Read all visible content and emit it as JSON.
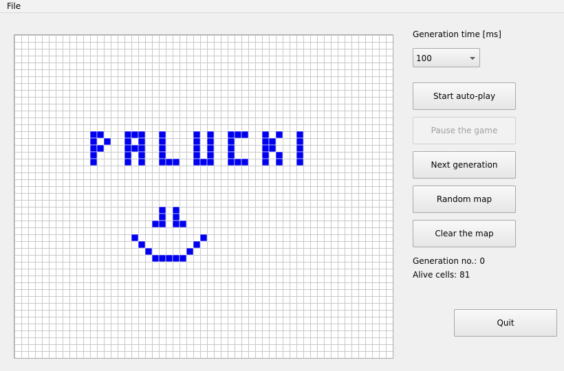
{
  "menu": {
    "file_label": "File"
  },
  "controls": {
    "generation_time_label": "Generation time [ms]",
    "generation_time_value": "100",
    "buttons": {
      "start": "Start auto-play",
      "pause": "Pause the game",
      "next": "Next generation",
      "random": "Random map",
      "clear": "Clear the map",
      "quit": "Quit"
    },
    "generation_no_label": "Generation no.:",
    "generation_no_value": "0",
    "alive_cells_label": "Alive cells:",
    "alive_cells_value": "81"
  },
  "colors": {
    "cell_alive": "#0000ee",
    "grid_line": "#c8c8c8",
    "grid_background": "#ffffff"
  },
  "board": {
    "columns": 55,
    "rows": 47,
    "alive_cells": [
      [
        11,
        14
      ],
      [
        11,
        15
      ],
      [
        11,
        16
      ],
      [
        11,
        17
      ],
      [
        11,
        18
      ],
      [
        12,
        14
      ],
      [
        12,
        16
      ],
      [
        13,
        15
      ],
      [
        16,
        14
      ],
      [
        16,
        15
      ],
      [
        16,
        16
      ],
      [
        16,
        17
      ],
      [
        16,
        18
      ],
      [
        17,
        14
      ],
      [
        17,
        16
      ],
      [
        18,
        14
      ],
      [
        18,
        15
      ],
      [
        18,
        16
      ],
      [
        18,
        17
      ],
      [
        18,
        18
      ],
      [
        21,
        14
      ],
      [
        21,
        15
      ],
      [
        21,
        16
      ],
      [
        21,
        17
      ],
      [
        21,
        18
      ],
      [
        22,
        18
      ],
      [
        23,
        18
      ],
      [
        26,
        14
      ],
      [
        26,
        15
      ],
      [
        26,
        16
      ],
      [
        26,
        17
      ],
      [
        26,
        18
      ],
      [
        27,
        18
      ],
      [
        28,
        14
      ],
      [
        28,
        15
      ],
      [
        28,
        16
      ],
      [
        28,
        17
      ],
      [
        28,
        18
      ],
      [
        31,
        14
      ],
      [
        31,
        15
      ],
      [
        31,
        16
      ],
      [
        31,
        17
      ],
      [
        31,
        18
      ],
      [
        32,
        14
      ],
      [
        32,
        18
      ],
      [
        33,
        14
      ],
      [
        33,
        18
      ],
      [
        36,
        14
      ],
      [
        36,
        15
      ],
      [
        36,
        16
      ],
      [
        36,
        17
      ],
      [
        36,
        18
      ],
      [
        37,
        15
      ],
      [
        37,
        16
      ],
      [
        38,
        14
      ],
      [
        38,
        17
      ],
      [
        38,
        18
      ],
      [
        41,
        14
      ],
      [
        41,
        15
      ],
      [
        41,
        16
      ],
      [
        41,
        17
      ],
      [
        41,
        18
      ],
      [
        20,
        27
      ],
      [
        21,
        25
      ],
      [
        21,
        26
      ],
      [
        21,
        27
      ],
      [
        23,
        25
      ],
      [
        23,
        26
      ],
      [
        23,
        27
      ],
      [
        24,
        27
      ],
      [
        17,
        29
      ],
      [
        18,
        30
      ],
      [
        19,
        31
      ],
      [
        20,
        32
      ],
      [
        21,
        32
      ],
      [
        22,
        32
      ],
      [
        23,
        32
      ],
      [
        24,
        32
      ],
      [
        25,
        31
      ],
      [
        26,
        30
      ],
      [
        27,
        29
      ]
    ]
  }
}
